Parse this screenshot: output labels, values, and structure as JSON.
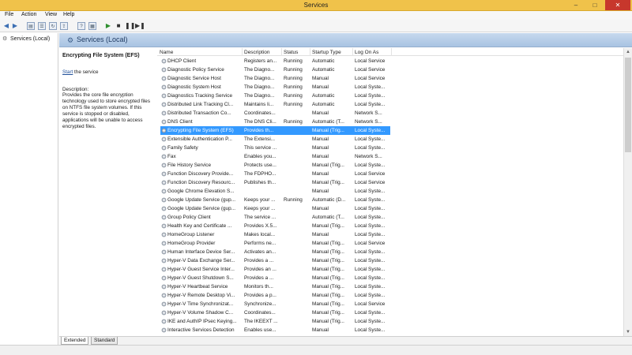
{
  "window": {
    "title": "Services",
    "minimize": "–",
    "maximize": "□",
    "close": "✕"
  },
  "menu": [
    "File",
    "Action",
    "View",
    "Help"
  ],
  "toolbar": [
    "back-icon",
    "forward-icon",
    "console-icon",
    "list-icon",
    "refresh-icon",
    "export-icon",
    "help-icon",
    "properties-icon",
    "play-icon",
    "stop-icon",
    "pause-icon",
    "restart-icon"
  ],
  "tree": {
    "root": "Services (Local)"
  },
  "panel": {
    "title": "Services (Local)"
  },
  "details": {
    "name": "Encrypting File System (EFS)",
    "start_link": "Start",
    "start_rest": " the service",
    "desc_label": "Description:",
    "desc_text": "Provides the core file encryption technology used to store encrypted files on NTFS file system volumes. If this service is stopped or disabled, applications will be unable to access encrypted files."
  },
  "columns": [
    "Name",
    "Description",
    "Status",
    "Startup Type",
    "Log On As"
  ],
  "rows": [
    [
      "DHCP Client",
      "Registers an...",
      "Running",
      "Automatic",
      "Local Service"
    ],
    [
      "Diagnostic Policy Service",
      "The Diagno...",
      "Running",
      "Automatic",
      "Local Service"
    ],
    [
      "Diagnostic Service Host",
      "The Diagno...",
      "Running",
      "Manual",
      "Local Service"
    ],
    [
      "Diagnostic System Host",
      "The Diagno...",
      "Running",
      "Manual",
      "Local Syste..."
    ],
    [
      "Diagnostics Tracking Service",
      "The Diagno...",
      "Running",
      "Automatic",
      "Local Syste..."
    ],
    [
      "Distributed Link Tracking Cl...",
      "Maintains li...",
      "Running",
      "Automatic",
      "Local Syste..."
    ],
    [
      "Distributed Transaction Co...",
      "Coordinates...",
      "",
      "Manual",
      "Network S..."
    ],
    [
      "DNS Client",
      "The DNS Cli...",
      "Running",
      "Automatic (T...",
      "Network S..."
    ],
    [
      "Encrypting File System (EFS)",
      "Provides th...",
      "",
      "Manual (Trig...",
      "Local Syste..."
    ],
    [
      "Extensible Authentication P...",
      "The Extensi...",
      "",
      "Manual",
      "Local Syste..."
    ],
    [
      "Family Safety",
      "This service ...",
      "",
      "Manual",
      "Local Syste..."
    ],
    [
      "Fax",
      "Enables you...",
      "",
      "Manual",
      "Network S..."
    ],
    [
      "File History Service",
      "Protects use...",
      "",
      "Manual (Trig...",
      "Local Syste..."
    ],
    [
      "Function Discovery Provide...",
      "The FDPHO...",
      "",
      "Manual",
      "Local Service"
    ],
    [
      "Function Discovery Resourc...",
      "Publishes th...",
      "",
      "Manual (Trig...",
      "Local Service"
    ],
    [
      "Google Chrome Elevation S...",
      "",
      "",
      "Manual",
      "Local Syste..."
    ],
    [
      "Google Update Service (gup...",
      "Keeps your ...",
      "Running",
      "Automatic (D...",
      "Local Syste..."
    ],
    [
      "Google Update Service (gup...",
      "Keeps your ...",
      "",
      "Manual",
      "Local Syste..."
    ],
    [
      "Group Policy Client",
      "The service ...",
      "",
      "Automatic (T...",
      "Local Syste..."
    ],
    [
      "Health Key and Certificate ...",
      "Provides X.5...",
      "",
      "Manual (Trig...",
      "Local Syste..."
    ],
    [
      "HomeGroup Listener",
      "Makes local...",
      "",
      "Manual",
      "Local Syste..."
    ],
    [
      "HomeGroup Provider",
      "Performs ne...",
      "",
      "Manual (Trig...",
      "Local Service"
    ],
    [
      "Human Interface Device Ser...",
      "Activates an...",
      "",
      "Manual (Trig...",
      "Local Syste..."
    ],
    [
      "Hyper-V Data Exchange Ser...",
      "Provides a ...",
      "",
      "Manual (Trig...",
      "Local Syste..."
    ],
    [
      "Hyper-V Guest Service Inter...",
      "Provides an ...",
      "",
      "Manual (Trig...",
      "Local Syste..."
    ],
    [
      "Hyper-V Guest Shutdown S...",
      "Provides a ...",
      "",
      "Manual (Trig...",
      "Local Syste..."
    ],
    [
      "Hyper-V Heartbeat Service",
      "Monitors th...",
      "",
      "Manual (Trig...",
      "Local Syste..."
    ],
    [
      "Hyper-V Remote Desktop Vi...",
      "Provides a p...",
      "",
      "Manual (Trig...",
      "Local Syste..."
    ],
    [
      "Hyper-V Time Synchronizat...",
      "Synchronize...",
      "",
      "Manual (Trig...",
      "Local Service"
    ],
    [
      "Hyper-V Volume Shadow C...",
      "Coordinates...",
      "",
      "Manual (Trig...",
      "Local Syste..."
    ],
    [
      "IKE and AuthIP IPsec Keying...",
      "The IKEEXT ...",
      "",
      "Manual (Trig...",
      "Local Syste..."
    ],
    [
      "Interactive Services Detection",
      "Enables use...",
      "",
      "Manual",
      "Local Syste..."
    ]
  ],
  "selected_row": 8,
  "tabs": [
    "Extended",
    "Standard"
  ],
  "active_tab": "Extended",
  "colors": {
    "selection": "#3399ff",
    "titlebar": "#f0c24a",
    "panel_header": "#b5cce8",
    "link": "#1f4f99"
  }
}
